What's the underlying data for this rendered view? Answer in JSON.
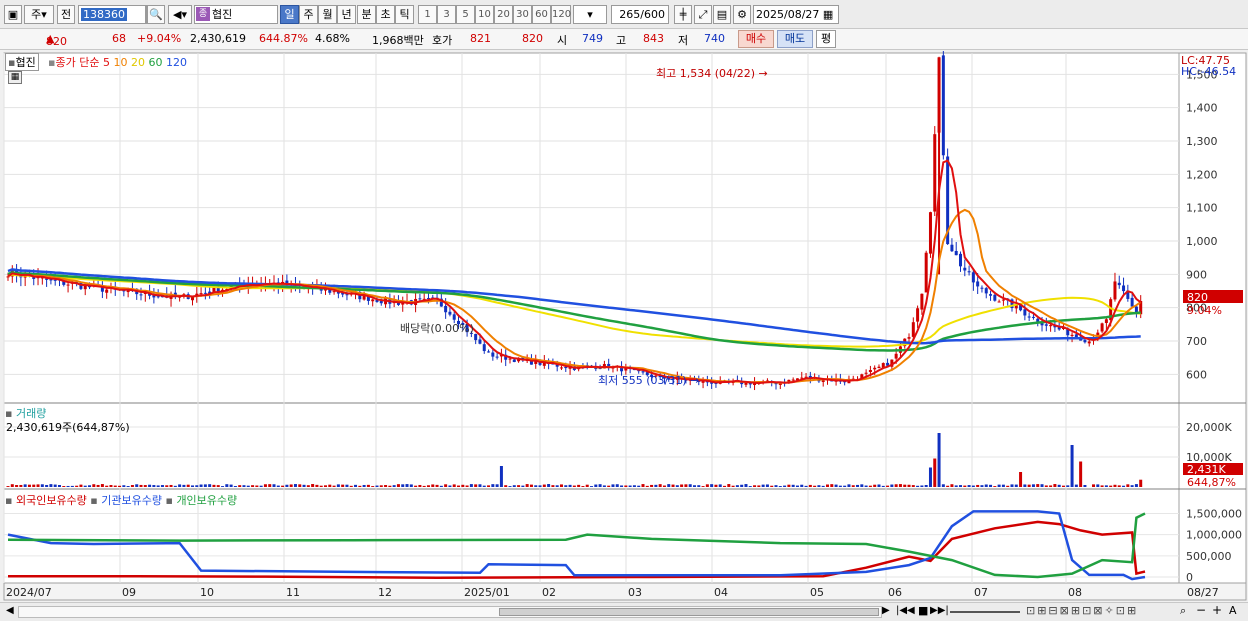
{
  "toolbar": {
    "menu_label": "주",
    "jeon": "전",
    "code": "138360",
    "stock_name": "협진",
    "badge": "종",
    "periods": [
      "일",
      "주",
      "월",
      "년",
      "분",
      "초",
      "틱"
    ],
    "active_period": "일",
    "intervals": [
      "1",
      "3",
      "5",
      "10",
      "20",
      "30",
      "60",
      "120"
    ],
    "count": "265",
    "max_count": "/600",
    "date": "2025/08/27"
  },
  "quote": {
    "price": "820",
    "change": "68",
    "pct": "+9.04%",
    "volume": "2,430,619",
    "vol_ratio": "644.87%",
    "turnover": "4.68%",
    "trade_value": "1,968백만",
    "hoga_label": "호가",
    "ask": "821",
    "bid": "820",
    "open_label": "시",
    "open": "749",
    "high_label": "고",
    "high": "843",
    "low_label": "저",
    "low": "740",
    "buy_label": "매수",
    "sell_label": "매도",
    "avg_label": "평"
  },
  "colors": {
    "up": "#d00000",
    "down": "#1030c0",
    "ma5": "#e01010",
    "ma10": "#f08000",
    "ma20": "#f0e000",
    "ma60": "#20a040",
    "ma120": "#2050e0"
  },
  "legend": {
    "title": "협진",
    "ma_label": "종가 단순 5",
    "ma10": "10",
    "ma20": "20",
    "ma60": "60",
    "ma120": "120"
  },
  "chart_data": [
    {
      "type": "candlestick",
      "title": "협진",
      "ylim": [
        550,
        1540
      ],
      "y_ticks": [
        "600",
        "700",
        "800",
        "900",
        "1,000",
        "1,100",
        "1,200",
        "1,300",
        "1,400",
        "1,500"
      ],
      "x_labels": [
        "2024/07",
        "09",
        "10",
        "11",
        "12",
        "2025/01",
        "02",
        "03",
        "04",
        "05",
        "06",
        "07",
        "08",
        "08/27"
      ],
      "lc": "LC:47.75",
      "hc": "HC:-46.54",
      "high_annotation": "최고 1,534 (04/22)",
      "low_annotation": "최저 555 (03/31)",
      "dividend_annotation": "배당락(0.00%)",
      "last_price": "820",
      "last_pct": "9.04%",
      "ma_start": {
        "ma120": 930,
        "ma60": 910,
        "ma20": 895
      },
      "ma_end": {
        "ma120": 722,
        "ma60": 735,
        "ma20": 780
      }
    },
    {
      "type": "bar",
      "title": "거래량",
      "current": "2,430,619주(644,87%)",
      "y_ticks": [
        "10,000K",
        "20,000K"
      ],
      "last_label": "2,431K",
      "last_pct": "644,87%"
    },
    {
      "type": "line",
      "series": [
        {
          "name": "외국인보유수량"
        },
        {
          "name": "기관보유수량"
        },
        {
          "name": "개인보유수량"
        }
      ],
      "y_ticks": [
        "0",
        "500,000",
        "1,000,000",
        "1,500,000"
      ]
    }
  ]
}
